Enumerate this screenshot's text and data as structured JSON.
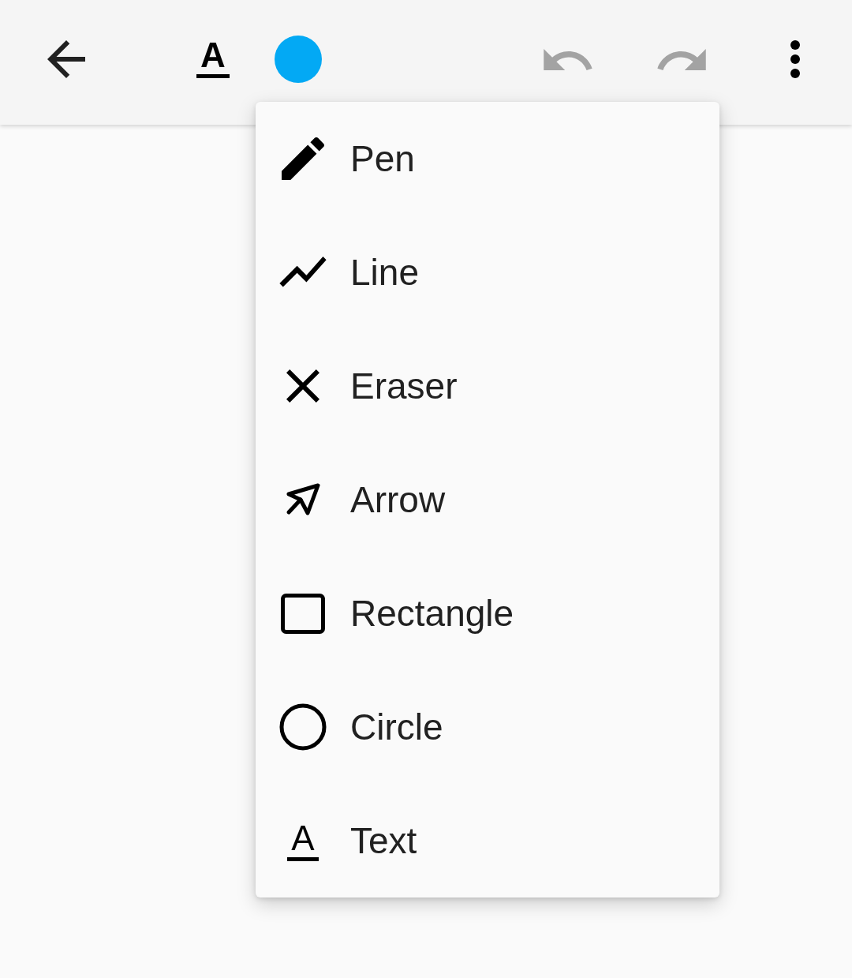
{
  "toolbar": {
    "items": [
      {
        "kind": "back"
      },
      {
        "kind": "tool",
        "glyph": "A"
      },
      {
        "kind": "color",
        "color": "#03a9f4"
      },
      {
        "kind": "undo",
        "disabled": true
      },
      {
        "kind": "redo",
        "disabled": true
      },
      {
        "kind": "more"
      }
    ]
  },
  "menu": {
    "items": [
      {
        "kind": "pen",
        "label": "Pen"
      },
      {
        "kind": "line",
        "label": "Line"
      },
      {
        "kind": "eraser",
        "label": "Eraser"
      },
      {
        "kind": "arrow",
        "label": "Arrow"
      },
      {
        "kind": "rectangle",
        "label": "Rectangle"
      },
      {
        "kind": "circle",
        "label": "Circle"
      },
      {
        "kind": "text",
        "label": "Text",
        "glyph": "A"
      }
    ]
  }
}
